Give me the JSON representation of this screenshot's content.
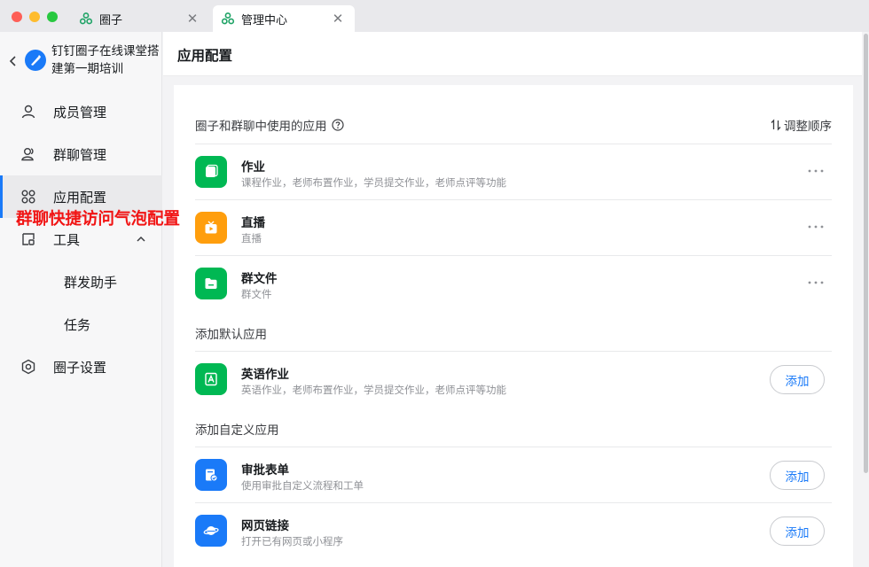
{
  "window": {
    "tabs": [
      {
        "label": "圈子",
        "icon": "dingtalk-circle-icon"
      },
      {
        "label": "管理中心",
        "icon": "dingtalk-circle-icon",
        "active": true
      }
    ]
  },
  "sidebar": {
    "org_name": "钉钉圈子在线课堂搭建第一期培训",
    "items": [
      {
        "label": "成员管理",
        "icon": "member-icon"
      },
      {
        "label": "群聊管理",
        "icon": "group-chat-icon"
      },
      {
        "label": "应用配置",
        "icon": "apps-grid-icon",
        "active": true
      },
      {
        "label": "工具",
        "icon": "tools-icon",
        "expanded": true
      },
      {
        "label": "群发助手"
      },
      {
        "label": "任务"
      },
      {
        "label": "圈子设置",
        "icon": "gear-icon"
      }
    ]
  },
  "annotation": "群聊快捷访问气泡配置",
  "main": {
    "title": "应用配置",
    "sections": {
      "in_use": {
        "title": "圈子和群聊中使用的应用",
        "reorder_label": "调整顺序",
        "apps": [
          {
            "name": "作业",
            "desc": "课程作业，老师布置作业，学员提交作业，老师点评等功能",
            "color": "#00b853"
          },
          {
            "name": "直播",
            "desc": "直播",
            "color": "#ff9e0d"
          },
          {
            "name": "群文件",
            "desc": "群文件",
            "color": "#00b853"
          }
        ]
      },
      "default": {
        "title": "添加默认应用",
        "apps": [
          {
            "name": "英语作业",
            "desc": "英语作业，老师布置作业，学员提交作业，老师点评等功能",
            "color": "#00b853",
            "action": "添加"
          }
        ]
      },
      "custom": {
        "title": "添加自定义应用",
        "apps": [
          {
            "name": "审批表单",
            "desc": "使用审批自定义流程和工单",
            "color": "#1a7af8",
            "action": "添加"
          },
          {
            "name": "网页链接",
            "desc": "打开已有网页或小程序",
            "color": "#1a7af8",
            "action": "添加"
          }
        ]
      }
    }
  }
}
